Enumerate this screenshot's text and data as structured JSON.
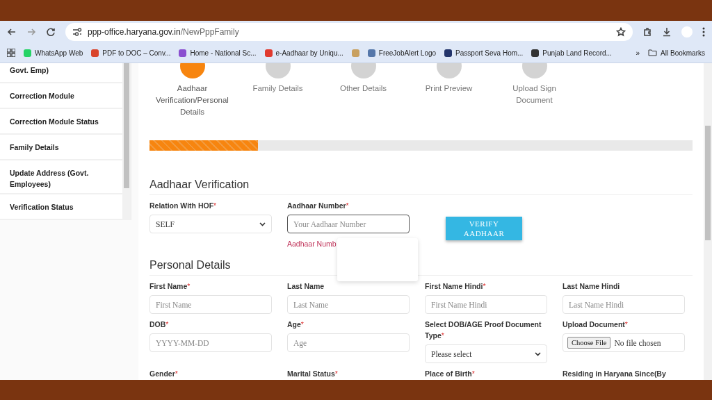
{
  "browser": {
    "url_host": "ppp-office.haryana.gov.in",
    "url_path": "/NewPppFamily",
    "bookmarks": [
      {
        "label": "WhatsApp Web",
        "color": "#25d366"
      },
      {
        "label": "PDF to DOC – Conv...",
        "color": "#d9442b"
      },
      {
        "label": "Home - National Sc...",
        "color": "#8a4fd0"
      },
      {
        "label": "e-Aadhaar by Uniqu...",
        "color": "#e03a2f"
      },
      {
        "color": "#c8a060"
      },
      {
        "label": "FreeJobAlert Logo",
        "color": "#5577aa"
      },
      {
        "label": "Passport Seva Hom...",
        "color": "#23346b"
      },
      {
        "label": "Punjab Land Record...",
        "color": "#333333"
      }
    ],
    "more": "»",
    "all_bookmarks": "All Bookmarks"
  },
  "sidebar": {
    "items": [
      {
        "label": "Govt. Emp)"
      },
      {
        "label": "Correction Module"
      },
      {
        "label": "Correction Module Status"
      },
      {
        "label": "Family Details"
      },
      {
        "label": "Update Address (Govt. Employees)"
      },
      {
        "label": "Verification Status"
      }
    ]
  },
  "steps": [
    {
      "label": "Aadhaar Verification/Personal Details",
      "active": true
    },
    {
      "label": "Family Details",
      "active": false
    },
    {
      "label": "Other Details",
      "active": false
    },
    {
      "label": "Print Preview",
      "active": false
    },
    {
      "label": "Upload Sign Document",
      "active": false
    }
  ],
  "progress": {
    "level": 0.2
  },
  "aadhaar_section": {
    "title": "Aadhaar Verification",
    "relation": {
      "label": "Relation With HOF",
      "required_mark": "*",
      "value": "SELF"
    },
    "aadhaar_number": {
      "label": "Aadhaar Number",
      "required_mark": "*",
      "placeholder": "Your Aadhaar Number",
      "error": "Aadhaar Numb"
    },
    "verify_button": "VERIFY AADHAAR"
  },
  "personal_section": {
    "title": "Personal Details",
    "fields": [
      {
        "kind": "text",
        "label": "First Name",
        "required_mark": "*",
        "placeholder": "First Name"
      },
      {
        "kind": "text",
        "label": "Last Name",
        "placeholder": "Last Name"
      },
      {
        "kind": "text",
        "label": "First Name Hindi",
        "required_mark": "*",
        "placeholder": "First Name Hindi"
      },
      {
        "kind": "text",
        "label": "Last Name Hindi",
        "placeholder": "Last Name Hindi"
      },
      {
        "kind": "text",
        "label": "DOB",
        "required_mark": "*",
        "placeholder": "YYYY-MM-DD"
      },
      {
        "kind": "text",
        "label": "Age",
        "required_mark": "*",
        "placeholder": "Age"
      },
      {
        "kind": "select",
        "label": "Select DOB/AGE Proof Document Type",
        "required_mark": "*",
        "value": "Please select"
      },
      {
        "kind": "file",
        "label": "Upload Document",
        "required_mark": "*",
        "button": "Choose File",
        "status": "No file chosen"
      },
      {
        "kind": "none",
        "label": "Gender",
        "required_mark": "*"
      },
      {
        "kind": "none",
        "label": "Marital Status",
        "required_mark": "*"
      },
      {
        "kind": "none",
        "label": "Place of Birth",
        "required_mark": "*"
      },
      {
        "kind": "none",
        "label": "Residing in Haryana Since(By"
      }
    ]
  }
}
